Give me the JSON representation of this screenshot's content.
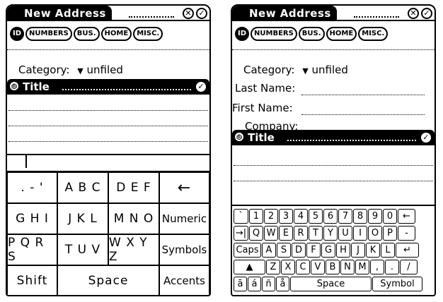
{
  "left": {
    "title": "New Address",
    "close_glyph": "✕",
    "ok_glyph": "✓",
    "tabs": [
      "ID",
      "NUMBERS",
      "BUS.",
      "HOME",
      "MISC."
    ],
    "category_label": "Category:",
    "category_value": "unfiled",
    "editor_title": "Title",
    "keypad": {
      "row1": [
        ". - '",
        "A B C",
        "D E F",
        "←"
      ],
      "row2": [
        "G H I",
        "J K L",
        "M N O",
        "Numeric"
      ],
      "row3": [
        "P Q R S",
        "T U V",
        "W X Y Z",
        "Symbols"
      ],
      "row4": [
        "Shift",
        "Space",
        "Accents"
      ]
    }
  },
  "right": {
    "title": "New Address",
    "close_glyph": "✕",
    "ok_glyph": "✓",
    "tabs": [
      "ID",
      "NUMBERS",
      "BUS.",
      "HOME",
      "MISC."
    ],
    "category_label": "Category:",
    "category_value": "unfiled",
    "last_name_label": "Last Name:",
    "first_name_label": "First Name:",
    "company_label": "Company:",
    "editor_title": "Title",
    "keyboard": {
      "row1": [
        "`",
        "1",
        "2",
        "3",
        "4",
        "5",
        "6",
        "7",
        "8",
        "9",
        "0",
        "←"
      ],
      "row2": [
        "→|",
        "Q",
        "W",
        "E",
        "R",
        "T",
        "Y",
        "U",
        "I",
        "O",
        "P",
        "-"
      ],
      "row3": [
        "Caps",
        "A",
        "S",
        "D",
        "F",
        "G",
        "H",
        "J",
        "K",
        "L",
        "↵"
      ],
      "row4": [
        "▲",
        "Z",
        "X",
        "C",
        "V",
        "B",
        "N",
        "M",
        ",",
        ".",
        "/"
      ],
      "row5": [
        "ā",
        "á",
        "ñ",
        "å",
        "Space",
        "Symbol"
      ]
    }
  }
}
